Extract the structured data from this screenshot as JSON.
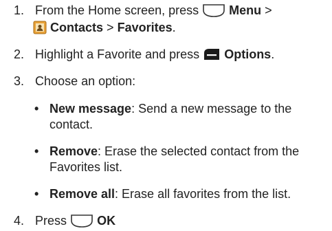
{
  "steps": [
    {
      "number": "1.",
      "pre": "From the Home screen, press",
      "menu_label": "Menu",
      "sep1": ">",
      "contacts_label": "Contacts",
      "sep2": ">",
      "favorites_label": "Favorites",
      "end": "."
    },
    {
      "number": "2.",
      "pre": "Highlight a Favorite and press",
      "options_label": "Options",
      "end": "."
    },
    {
      "number": "3.",
      "text": "Choose an option:"
    },
    {
      "number": "4.",
      "pre": "Press",
      "ok_label": "OK"
    }
  ],
  "options": [
    {
      "bullet": "•",
      "label": "New message",
      "desc_line1": ": Send a new message to the",
      "desc_line2": "contact."
    },
    {
      "bullet": "•",
      "label": "Remove",
      "desc_line1": ": Erase the selected contact from the",
      "desc_line2": "Favorites list."
    },
    {
      "bullet": "•",
      "label": "Remove all",
      "desc_line1": ": Erase all favorites from the list."
    }
  ],
  "icons": {
    "soft_key": "center-soft-key-icon",
    "contacts": "contacts-app-icon",
    "options": "right-soft-key-icon"
  },
  "colors": {
    "text": "#222222",
    "key_fill": "#ffffff",
    "key_stroke": "#333333",
    "options_key_fill": "#1a1a1a",
    "contacts_icon": "#e8a23a"
  }
}
